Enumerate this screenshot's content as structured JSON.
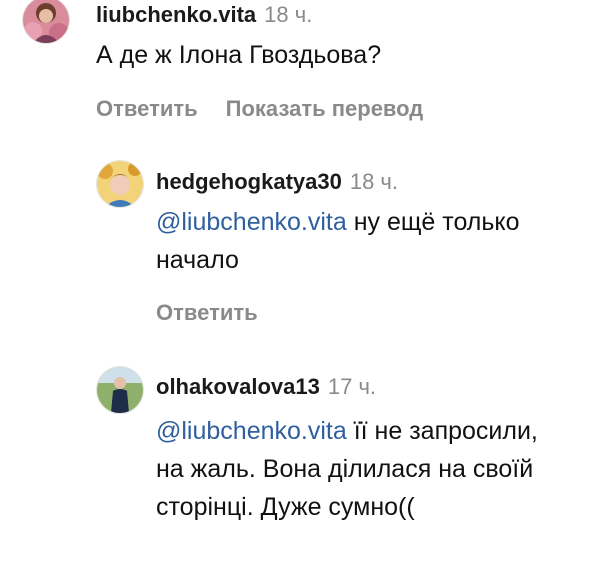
{
  "comments": [
    {
      "username": "liubchenko.vita",
      "time": "18 ч.",
      "mention": "",
      "text": "А де ж Ілона Гвоздьова?",
      "actions": [
        "Ответить",
        "Показать перевод"
      ]
    },
    {
      "username": "hedgehogkatya30",
      "time": "18 ч.",
      "mention": "@liubchenko.vita",
      "text": " ну ещё только начало",
      "actions": [
        "Ответить"
      ]
    },
    {
      "username": "olhakovalova13",
      "time": "17 ч.",
      "mention": "@liubchenko.vita",
      "text": " її не запросили, на жаль. Вона ділилася на своїй сторінці. Дуже сумно((",
      "actions": []
    }
  ],
  "colors": {
    "mention": "#2f5f9e",
    "meta": "#8a8a8a"
  }
}
